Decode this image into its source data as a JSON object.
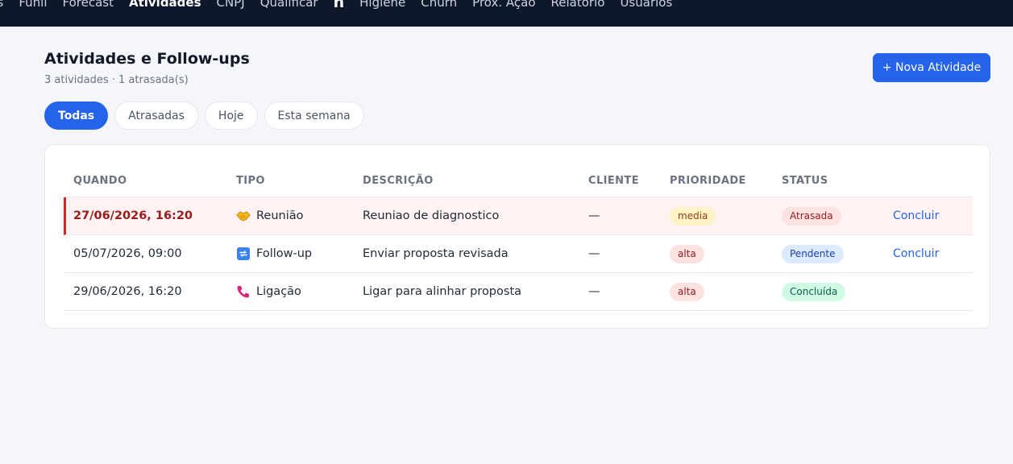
{
  "nav": {
    "items": [
      {
        "label": "ds",
        "active": false
      },
      {
        "label": "Funil",
        "active": false
      },
      {
        "label": "Forecast",
        "active": false
      },
      {
        "label": "Atividades",
        "active": true
      },
      {
        "label": "CNPJ",
        "active": false
      },
      {
        "label": "Qualificar",
        "active": false
      },
      {
        "label": "h",
        "active": false,
        "glyph": true
      },
      {
        "label": "Higiene",
        "active": false
      },
      {
        "label": "Churn",
        "active": false
      },
      {
        "label": "Próx. Ação",
        "active": false
      },
      {
        "label": "Relatório",
        "active": false
      },
      {
        "label": "Usuários",
        "active": false
      }
    ]
  },
  "header": {
    "title": "Atividades e Follow-ups",
    "subtitle": "3 atividades · 1 atrasada(s)",
    "new_button": "+ Nova Atividade"
  },
  "filters": [
    {
      "label": "Todas",
      "active": true
    },
    {
      "label": "Atrasadas",
      "active": false
    },
    {
      "label": "Hoje",
      "active": false
    },
    {
      "label": "Esta semana",
      "active": false
    }
  ],
  "table": {
    "columns": {
      "when": "QUANDO",
      "tipo": "TIPO",
      "desc": "DESCRIÇÃO",
      "cliente": "CLIENTE",
      "prioridade": "PRIORIDADE",
      "status": "STATUS"
    },
    "rows": [
      {
        "when": "27/06/2026, 16:20",
        "tipo": "Reunião",
        "tipo_icon": "handshake-icon",
        "desc": "Reuniao de diagnostico",
        "cliente": "—",
        "prioridade": "media",
        "status": "Atrasada",
        "action": "Concluir",
        "overdue": true
      },
      {
        "when": "05/07/2026, 09:00",
        "tipo": "Follow-up",
        "tipo_icon": "repeat-icon",
        "desc": "Enviar proposta revisada",
        "cliente": "—",
        "prioridade": "alta",
        "status": "Pendente",
        "action": "Concluir",
        "overdue": false
      },
      {
        "when": "29/06/2026, 16:20",
        "tipo": "Ligação",
        "tipo_icon": "phone-icon",
        "desc": "Ligar para alinhar proposta",
        "cliente": "—",
        "prioridade": "alta",
        "status": "Concluída",
        "action": "",
        "overdue": false
      }
    ]
  },
  "colors": {
    "accent": "#2563eb",
    "overdue_bg": "#fef2f2",
    "overdue_border": "#dc2626",
    "priority_media_bg": "#fef3c7",
    "priority_media_fg": "#92400e",
    "priority_alta_bg": "#fde2e2",
    "priority_alta_fg": "#991b1b",
    "status_atrasada_bg": "#fde2e2",
    "status_atrasada_fg": "#991b1b",
    "status_pendente_bg": "#dbeafe",
    "status_pendente_fg": "#1e40af",
    "status_concluida_bg": "#d1fae5",
    "status_concluida_fg": "#065f46"
  }
}
